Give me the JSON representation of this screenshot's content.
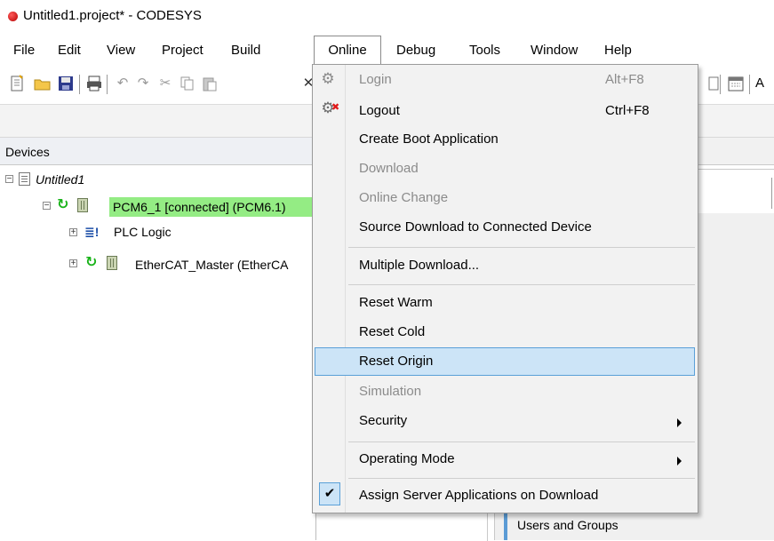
{
  "window": {
    "title": "Untitled1.project* - CODESYS"
  },
  "menubar": {
    "items": [
      "File",
      "Edit",
      "View",
      "Project",
      "Build",
      "Online",
      "Debug",
      "Tools",
      "Window",
      "Help"
    ]
  },
  "toolbar": {
    "trailing_label": "A"
  },
  "devices": {
    "title": "Devices",
    "tree": {
      "root": "Untitled1",
      "device": "PCM6_1 [connected] (PCM6.1)",
      "plc_logic": "PLC Logic",
      "ethercat": "EtherCAT_Master (EtherCA"
    }
  },
  "right_pane": {
    "users_and_groups": "Users and Groups"
  },
  "online_menu": {
    "items": [
      {
        "label": "Login",
        "shortcut": "Alt+F8",
        "enabled": false,
        "icon": "login-gear-icon"
      },
      {
        "label": "Logout",
        "shortcut": "Ctrl+F8",
        "enabled": true,
        "icon": "logout-gear-icon"
      },
      {
        "label": "Create Boot Application",
        "enabled": true
      },
      {
        "label": "Download",
        "enabled": false
      },
      {
        "label": "Online Change",
        "enabled": false
      },
      {
        "label": "Source Download to Connected Device",
        "enabled": true
      },
      {
        "label": "Multiple Download...",
        "enabled": true
      },
      {
        "label": "Reset Warm",
        "enabled": true
      },
      {
        "label": "Reset Cold",
        "enabled": true
      },
      {
        "label": "Reset Origin",
        "enabled": true,
        "hovered": true
      },
      {
        "label": "Simulation",
        "enabled": false
      },
      {
        "label": "Security",
        "enabled": true,
        "submenu": true
      },
      {
        "label": "Operating Mode",
        "enabled": true,
        "submenu": true
      },
      {
        "label": "Assign Server Applications on Download",
        "enabled": true,
        "checked": true
      }
    ]
  },
  "colors": {
    "connected_highlight": "#94ec84",
    "hover_fill": "#cce4f7",
    "hover_border": "#5aa0d8",
    "disabled_text": "#8b8b8b"
  }
}
